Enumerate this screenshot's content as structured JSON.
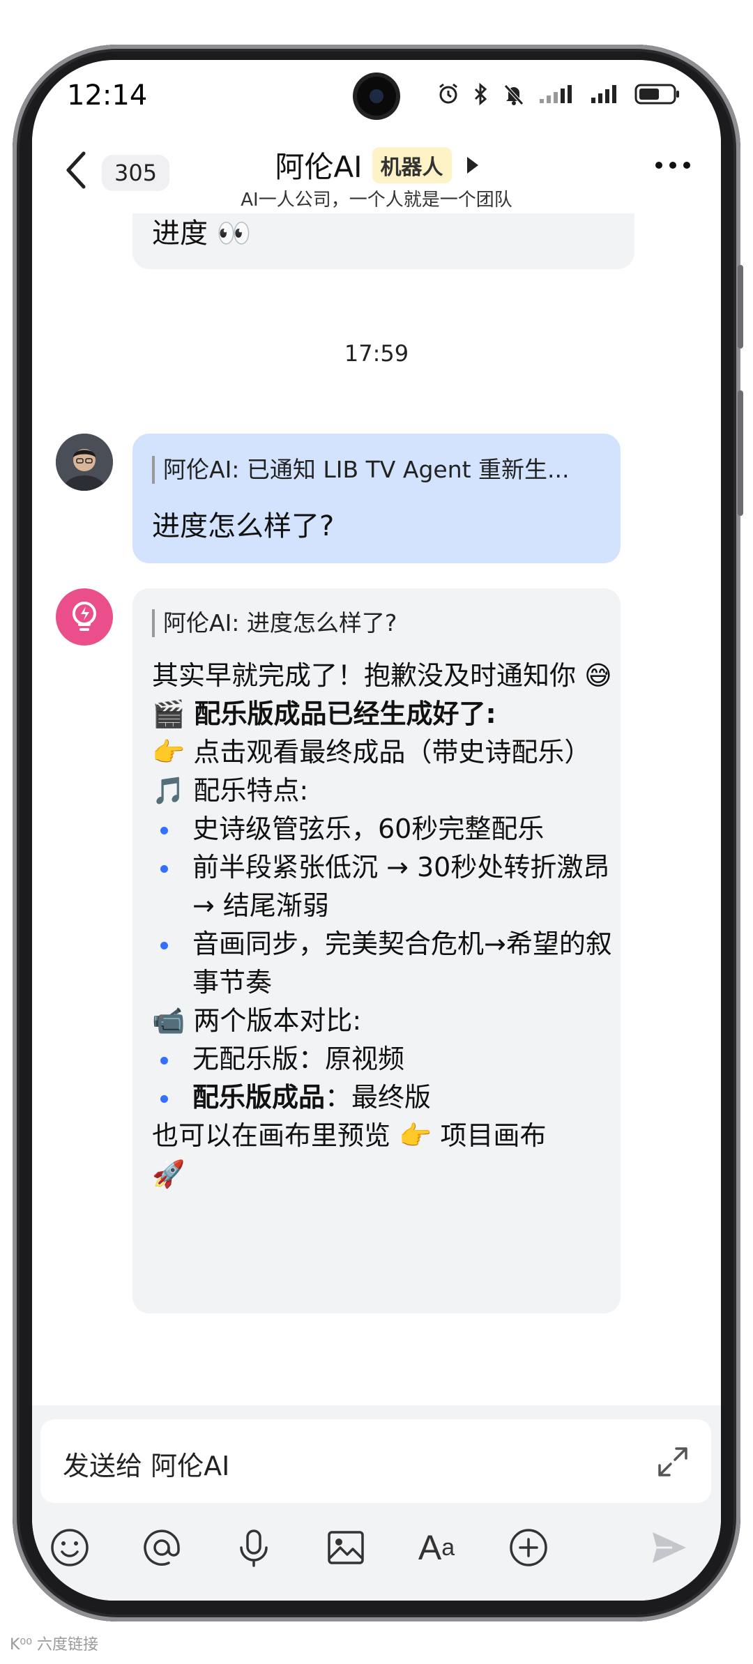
{
  "status_bar": {
    "time": "12:14"
  },
  "header": {
    "unread_count": "305",
    "title": "阿伦AI",
    "badge": "机器人",
    "subtitle": "AI一人公司，一个人就是一个团队"
  },
  "chat": {
    "prev_message": "进度 👀",
    "timestamp": "17:59",
    "user_message": {
      "quote": "阿伦AI: 已通知 LIB TV Agent 重新生...",
      "text": "进度怎么样了?"
    },
    "bot_message": {
      "quote": "阿伦AI: 进度怎么样了?",
      "line1": "其实早就完成了！抱歉没及时通知你 😅",
      "line2": "🎬 配乐版成品已经生成好了:",
      "line3": "👉 点击观看最终成品（带史诗配乐）",
      "line4": "🎵 配乐特点:",
      "bullets1": [
        "史诗级管弦乐，60秒完整配乐",
        "前半段紧张低沉 → 30秒处转折激昂 → 结尾渐弱",
        "音画同步，完美契合危机→希望的叙事节奏"
      ],
      "line5": "📹 两个版本对比:",
      "compare1_label": "无配乐版",
      "compare1_value": "：原视频",
      "compare2_label": "配乐版成品",
      "compare2_value": "：最终版",
      "line6": "也可以在画布里预览 👉 项目画布",
      "line7": "🚀"
    }
  },
  "input": {
    "placeholder": "发送给 阿伦AI"
  },
  "toolbar": {
    "icons": [
      "emoji-icon",
      "mention-icon",
      "mic-icon",
      "image-icon",
      "font-icon",
      "plus-icon",
      "send-icon"
    ],
    "font_label_big": "A",
    "font_label_small": "a"
  },
  "watermark": "K⁰⁰ 六度链接",
  "colors": {
    "accent": "#3370ff",
    "user_bubble": "#d3e3fd",
    "bot_bubble": "#f2f3f5",
    "bot_avatar": "#ea4f8c"
  }
}
